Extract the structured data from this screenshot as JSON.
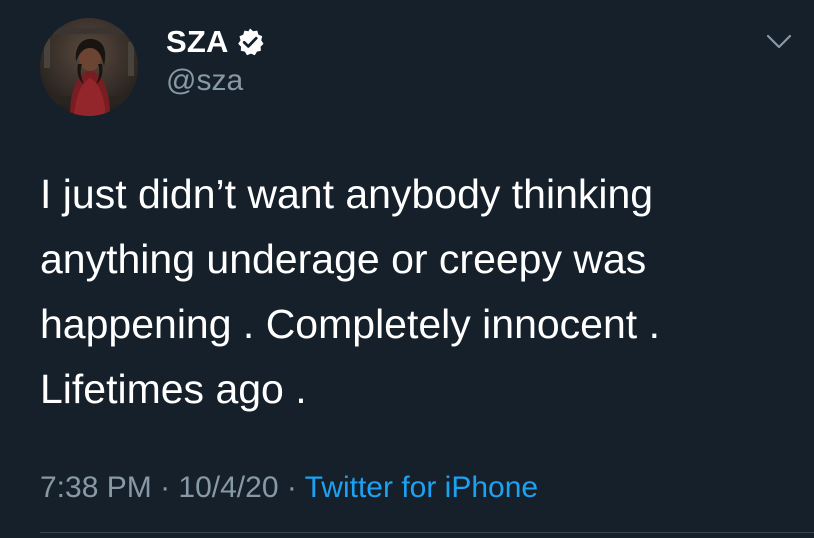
{
  "author": {
    "display_name": "SZA",
    "handle": "@sza",
    "verified": true,
    "avatar_icon": "profile-photo"
  },
  "tweet": {
    "text_lines": [
      "I just didn’t want anybody thinking",
      "anything underage or creepy was",
      "happening . Completely innocent .",
      "Lifetimes ago ."
    ],
    "time": "7:38 PM",
    "separator": "·",
    "date": "10/4/20",
    "source": "Twitter for iPhone"
  },
  "icons": {
    "verified": "verified-badge-icon",
    "menu": "chevron-down-icon"
  },
  "colors": {
    "background": "#15202b",
    "primary_text": "#ffffff",
    "secondary_text": "#8899a6",
    "link": "#1da1f2"
  }
}
